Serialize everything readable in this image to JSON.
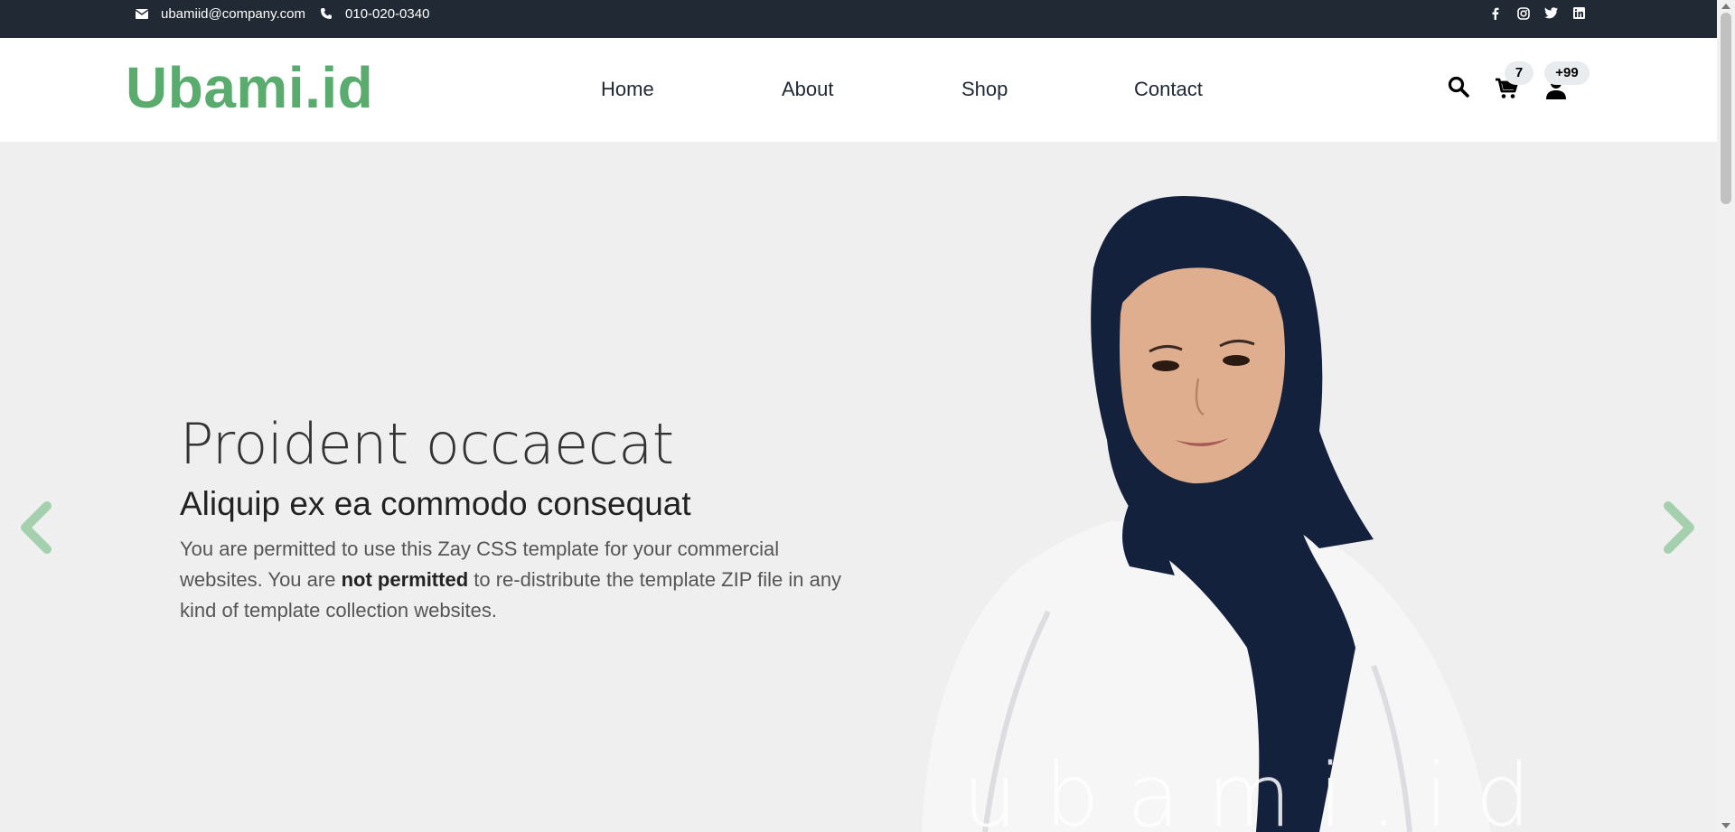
{
  "topbar": {
    "email": "ubamiid@company.com",
    "phone": "010-020-0340",
    "social": [
      "facebook-icon",
      "instagram-icon",
      "twitter-icon",
      "linkedin-icon"
    ]
  },
  "nav": {
    "logo": "Ubami.id",
    "menu": [
      "Home",
      "About",
      "Shop",
      "Contact"
    ],
    "cart_count": "7",
    "user_count": "+99"
  },
  "hero": {
    "title": "Proident occaecat",
    "subtitle": "Aliquip ex ea commodo consequat",
    "para_1": "You are permitted to use this Zay CSS template for your commercial websites. You are ",
    "para_bold": "not permitted",
    "para_2": " to re-distribute the template ZIP file in any kind of template collection websites.",
    "watermark": "ubami.id"
  },
  "colors": {
    "accent": "#59ab6e",
    "topbar": "#212934",
    "hero_bg": "#efefef"
  }
}
